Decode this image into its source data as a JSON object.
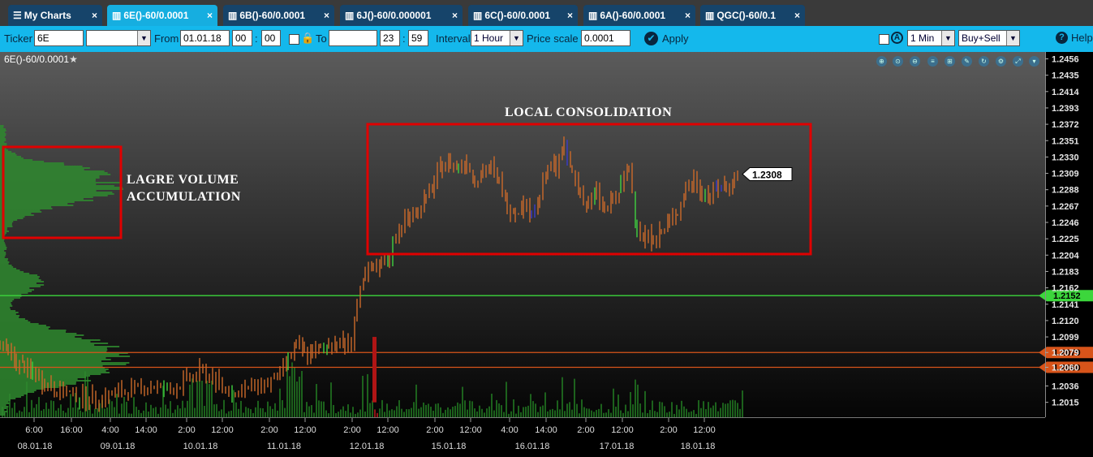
{
  "tabs": [
    {
      "label": "My Charts",
      "icon": "menu-icon"
    },
    {
      "label": "6E()-60/0.0001",
      "icon": "chart-icon",
      "active": true
    },
    {
      "label": "6B()-60/0.0001",
      "icon": "chart-icon"
    },
    {
      "label": "6J()-60/0.000001",
      "icon": "chart-icon"
    },
    {
      "label": "6C()-60/0.0001",
      "icon": "chart-icon"
    },
    {
      "label": "6A()-60/0.0001",
      "icon": "chart-icon"
    },
    {
      "label": "QGC()-60/0.1",
      "icon": "chart-icon"
    }
  ],
  "toolbar": {
    "ticker_label": "Ticker",
    "ticker_value": "6E",
    "from_label": "From",
    "from_date": "01.01.18",
    "from_hour": "00",
    "from_min": "00",
    "to_label": "To",
    "to_date": "",
    "to_hour": "23",
    "to_min": "59",
    "interval_label": "Interval",
    "interval_value": "1 Hour",
    "price_scale_label": "Price scale",
    "price_scale_value": "0.0001",
    "apply_label": "Apply",
    "timeframe_value": "1 Min",
    "side_value": "Buy+Sell",
    "help_label": "Help"
  },
  "chart": {
    "title": "6E()-60/0.0001",
    "annotations": {
      "volume_l1": "LAGRE VOLUME",
      "volume_l2": "ACCUMULATION",
      "consolidation": "LOCAL CONSOLIDATION"
    },
    "colors": {
      "bg_top": "#5a5a5a",
      "bg_bottom": "#000000",
      "bar": "#cc6a2a",
      "bar_up": "#3fd23f",
      "bar_down": "#3b3bcc",
      "volume": "#1f6b1f",
      "profile": "#2f8a2f",
      "box": "#e00000",
      "green_line": "#3cd63c",
      "orange_line": "#d8541a"
    }
  },
  "chart_data": {
    "type": "candlestick",
    "y_ticks": [
      1.2456,
      1.2435,
      1.2414,
      1.2393,
      1.2372,
      1.2351,
      1.233,
      1.2309,
      1.2288,
      1.2267,
      1.2246,
      1.2225,
      1.2204,
      1.2183,
      1.2162,
      1.2141,
      1.212,
      1.2099,
      1.2079,
      1.206,
      1.2036,
      1.2015
    ],
    "ylim": [
      1.2002,
      1.2466
    ],
    "current_price": "1.2308",
    "levels": [
      {
        "value": 1.2152,
        "label": "1.2152",
        "color": "#3cd63c"
      },
      {
        "value": 1.2079,
        "label": "1.2079",
        "color": "#d8541a"
      },
      {
        "value": 1.206,
        "label": "1.2060",
        "color": "#d8541a"
      }
    ],
    "x_time_ticks": [
      "6:00",
      "16:00",
      "4:00",
      "14:00",
      "2:00",
      "12:00",
      "2:00",
      "12:00",
      "2:00",
      "12:00",
      "2:00",
      "12:00",
      "4:00",
      "14:00",
      "2:00",
      "12:00",
      "2:00",
      "12:00"
    ],
    "x_date_ticks": [
      "08.01.18",
      "09.01.18",
      "10.01.18",
      "11.01.18",
      "12.01.18",
      "15.01.18",
      "16.01.18",
      "17.01.18",
      "18.01.18"
    ],
    "price_path": [
      [
        0,
        1.2091
      ],
      [
        10,
        1.208
      ],
      [
        20,
        1.2066
      ],
      [
        30,
        1.206
      ],
      [
        40,
        1.2052
      ],
      [
        55,
        1.204
      ],
      [
        70,
        1.203
      ],
      [
        90,
        1.2025
      ],
      [
        110,
        1.202
      ],
      [
        130,
        1.2022
      ],
      [
        150,
        1.2028
      ],
      [
        170,
        1.2033
      ],
      [
        190,
        1.2036
      ],
      [
        210,
        1.203
      ],
      [
        230,
        1.2044
      ],
      [
        250,
        1.2055
      ],
      [
        270,
        1.2038
      ],
      [
        290,
        1.2027
      ],
      [
        310,
        1.2034
      ],
      [
        330,
        1.204
      ],
      [
        345,
        1.205
      ],
      [
        355,
        1.2072
      ],
      [
        365,
        1.2085
      ],
      [
        375,
        1.208
      ],
      [
        385,
        1.2077
      ],
      [
        395,
        1.2083
      ],
      [
        405,
        1.209
      ],
      [
        415,
        1.2093
      ],
      [
        425,
        1.2088
      ],
      [
        433,
        1.2096
      ],
      [
        440,
        1.214
      ],
      [
        450,
        1.2175
      ],
      [
        460,
        1.2185
      ],
      [
        470,
        1.2195
      ],
      [
        480,
        1.2205
      ],
      [
        488,
        1.2222
      ],
      [
        495,
        1.2245
      ],
      [
        505,
        1.2256
      ],
      [
        515,
        1.2262
      ],
      [
        525,
        1.2275
      ],
      [
        535,
        1.2296
      ],
      [
        545,
        1.232
      ],
      [
        555,
        1.2322
      ],
      [
        565,
        1.2318
      ],
      [
        575,
        1.2325
      ],
      [
        585,
        1.2302
      ],
      [
        595,
        1.231
      ],
      [
        605,
        1.2316
      ],
      [
        615,
        1.2296
      ],
      [
        625,
        1.2268
      ],
      [
        635,
        1.2262
      ],
      [
        645,
        1.227
      ],
      [
        655,
        1.2258
      ],
      [
        665,
        1.228
      ],
      [
        675,
        1.2312
      ],
      [
        685,
        1.232
      ],
      [
        695,
        1.234
      ],
      [
        705,
        1.231
      ],
      [
        715,
        1.2286
      ],
      [
        725,
        1.2266
      ],
      [
        735,
        1.2285
      ],
      [
        745,
        1.2262
      ],
      [
        755,
        1.2272
      ],
      [
        765,
        1.229
      ],
      [
        775,
        1.2316
      ],
      [
        785,
        1.2242
      ],
      [
        795,
        1.2225
      ],
      [
        805,
        1.2228
      ],
      [
        815,
        1.2232
      ],
      [
        825,
        1.2246
      ],
      [
        835,
        1.2262
      ],
      [
        845,
        1.2286
      ],
      [
        855,
        1.23
      ],
      [
        865,
        1.2286
      ],
      [
        875,
        1.2282
      ],
      [
        885,
        1.229
      ],
      [
        895,
        1.2292
      ],
      [
        905,
        1.2302
      ],
      [
        912,
        1.2308
      ]
    ]
  }
}
